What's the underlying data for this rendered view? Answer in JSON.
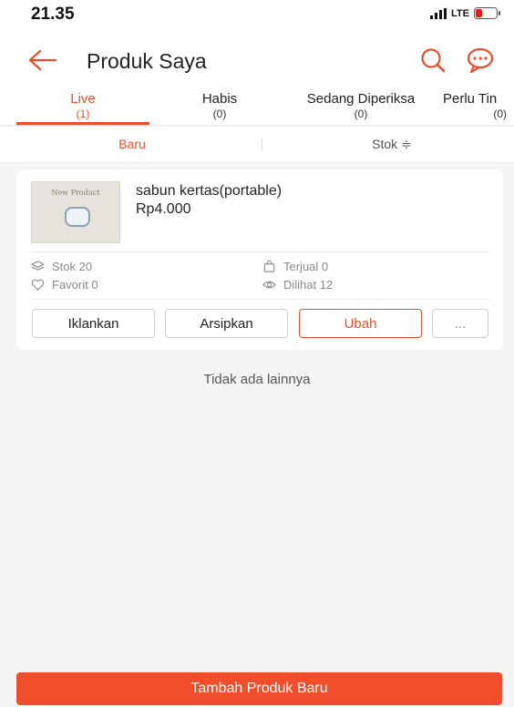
{
  "status_bar": {
    "time": "21.35",
    "network": "LTE"
  },
  "header": {
    "title": "Produk Saya",
    "back_icon": "arrow-left-icon",
    "search_icon": "search-icon",
    "chat_icon": "chat-icon"
  },
  "tabs": [
    {
      "label": "Live",
      "count": "(1)",
      "active": true
    },
    {
      "label": "Habis",
      "count": "(0)",
      "active": false
    },
    {
      "label": "Sedang Diperiksa",
      "count": "(0)",
      "active": false
    },
    {
      "label": "Perlu Tin",
      "count": "(0)",
      "active": false
    }
  ],
  "sort": {
    "new_label": "Baru",
    "stock_label": "Stok ≑"
  },
  "product": {
    "name": "sabun kertas(portable)",
    "price": "Rp4.000",
    "thumbnail_text": "New Product",
    "stats": {
      "stock": "Stok 20",
      "sold": "Terjual 0",
      "favorite": "Favorit 0",
      "views": "Dilihat 12"
    },
    "actions": {
      "advertise": "Iklankan",
      "archive": "Arsipkan",
      "edit": "Ubah",
      "more": "..."
    }
  },
  "list_end_text": "Tidak ada lainnya",
  "footer": {
    "add_button_label": "Tambah Produk Baru"
  },
  "colors": {
    "accent": "#ee4d2d",
    "button": "#f04e2d",
    "background": "#f5f5f5"
  }
}
